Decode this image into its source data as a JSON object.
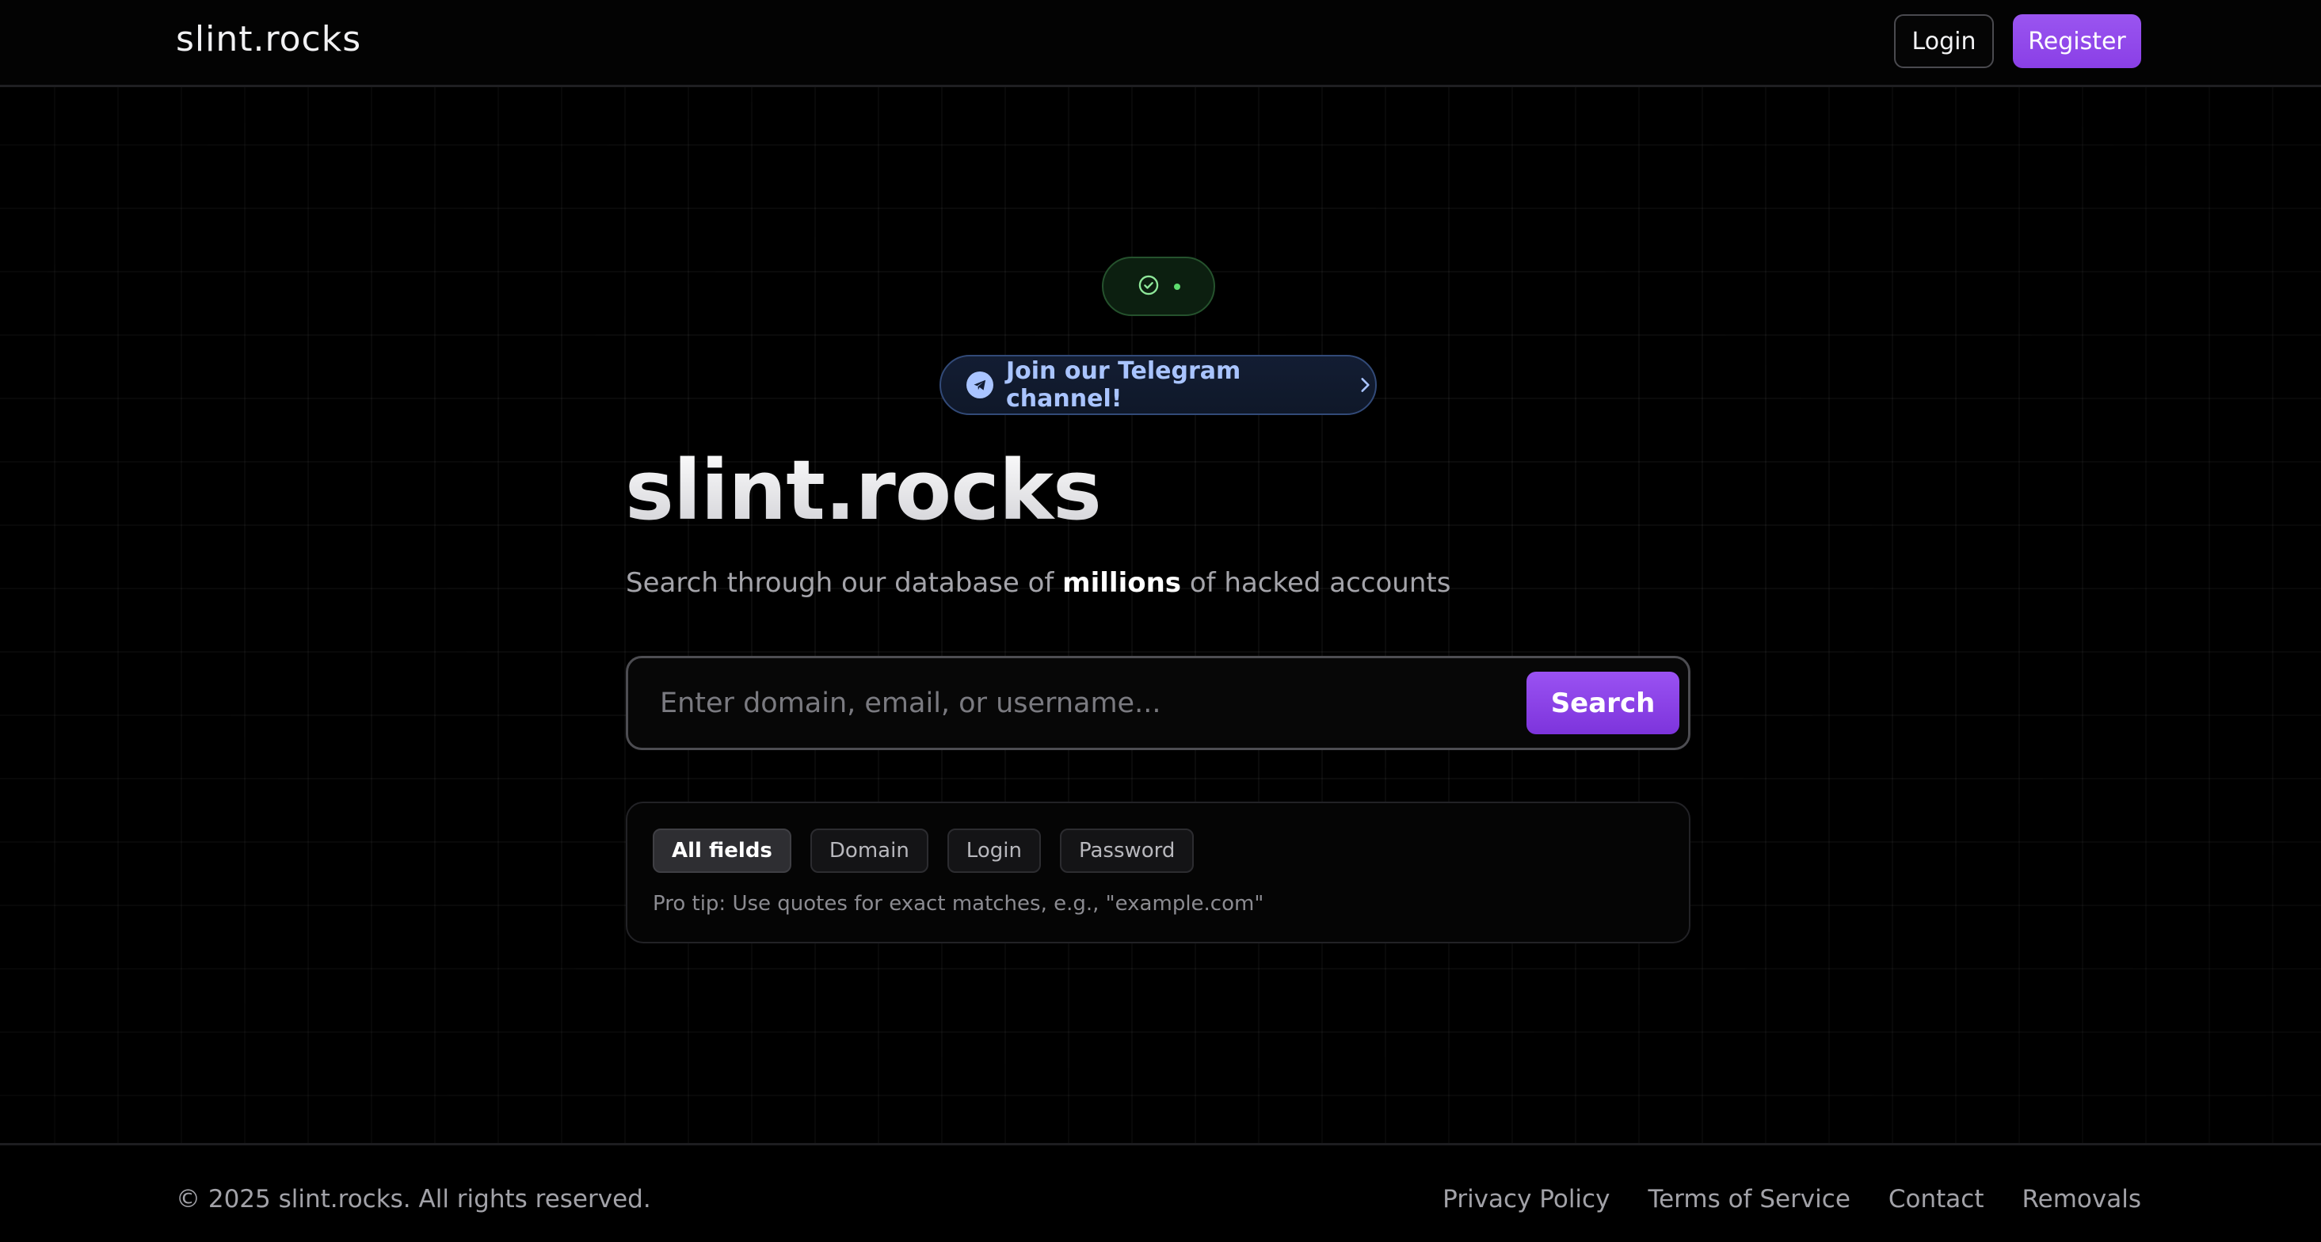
{
  "header": {
    "brand": "slint.rocks",
    "login_label": "Login",
    "register_label": "Register"
  },
  "status": {
    "icon": "check-circle-icon",
    "color": "#5ddc6e"
  },
  "announcement": {
    "icon": "telegram-icon",
    "label": "Join our Telegram channel!",
    "chevron": "chevron-right-icon"
  },
  "hero": {
    "title": "slint.rocks",
    "subtitle_before": "Search through our database of ",
    "subtitle_bold": "millions",
    "subtitle_after": " of hacked accounts"
  },
  "search": {
    "placeholder": "Enter domain, email, or username...",
    "value": "",
    "button_label": "Search"
  },
  "filters": {
    "chips": [
      {
        "label": "All fields",
        "active": true
      },
      {
        "label": "Domain",
        "active": false
      },
      {
        "label": "Login",
        "active": false
      },
      {
        "label": "Password",
        "active": false
      }
    ],
    "pro_tip": "Pro tip: Use quotes for exact matches, e.g., \"example.com\""
  },
  "footer": {
    "copyright": "© 2025 slint.rocks. All rights reserved.",
    "links": [
      "Privacy Policy",
      "Terms of Service",
      "Contact",
      "Removals"
    ]
  },
  "colors": {
    "accent": "#8a3fe6",
    "telegram": "#a9c4ff",
    "background": "#000000"
  }
}
